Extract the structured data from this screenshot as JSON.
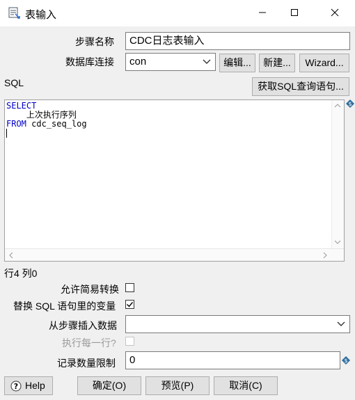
{
  "window": {
    "title": "表输入",
    "minimize_icon": "minimize-icon",
    "maximize_icon": "maximize-icon",
    "close_icon": "close-icon"
  },
  "form": {
    "step_name_label": "步骤名称",
    "step_name_value": "CDC日志表输入",
    "db_conn_label": "数据库连接",
    "db_conn_value": "con",
    "edit_button": "编辑...",
    "new_button": "新建...",
    "wizard_button": "Wizard...",
    "sql_label": "SQL",
    "get_sql_button": "获取SQL查询语句..."
  },
  "editor": {
    "line1": "SELECT",
    "line2": "    上次执行序列",
    "line3_kw": "FROM",
    "line3_rest": " cdc_seq_log",
    "position": "行4 列0"
  },
  "options": {
    "lazy_conversion_label": "允许简易转换",
    "lazy_conversion_checked": false,
    "replace_vars_label": "替换 SQL 语句里的变量",
    "replace_vars_checked": true,
    "insert_from_step_label": "从步骤插入数据",
    "insert_from_step_value": "",
    "execute_each_row_label": "执行每一行?",
    "execute_each_row_checked": false,
    "limit_label": "记录数量限制",
    "limit_value": "0"
  },
  "footer": {
    "help_button": "Help",
    "ok_button": "确定(O)",
    "preview_button": "预览(P)",
    "cancel_button": "取消(C)"
  },
  "colors": {
    "keyword": "#0000c8",
    "dialog_bg": "#f0f0f0"
  }
}
